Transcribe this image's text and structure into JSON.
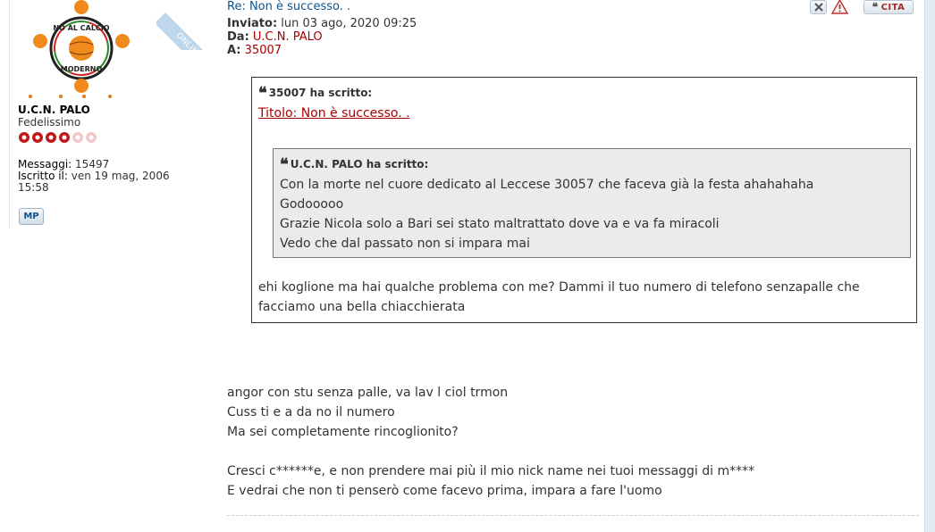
{
  "profile": {
    "username": "U.C.N. PALO",
    "rank": "Fedelissimo",
    "online_label": "ONLINE",
    "avatar_text": [
      "NO AL CALCIO",
      "MODERNO"
    ],
    "stats": [
      {
        "label": "Messaggi:",
        "value": "15497"
      },
      {
        "label": "Iscritto il:",
        "value": "ven 19 mag, 2006 15:58"
      }
    ],
    "pm_label": "MP",
    "rank_stars_filled": 4,
    "rank_stars_total": 6
  },
  "post": {
    "title": "Re: Non è successo. .",
    "sent_label": "Inviato:",
    "sent_value": "lun 03 ago, 2020 09:25",
    "from_label": "Da:",
    "from_value": "U.C.N. PALO",
    "to_label": "A:",
    "to_value": "35007"
  },
  "actions": {
    "delete_icon": "close-icon",
    "report_icon": "warning-icon",
    "quote_label": "CITA"
  },
  "quote": {
    "author_line": "35007 ha scritto:",
    "link_text": "Titolo: Non è successo. .",
    "inner": {
      "author_line": "U.C.N. PALO ha scritto:",
      "lines": [
        "Con la morte nel cuore dedicato al Leccese 30057 che faceva già la festa ahahahaha",
        "Godooooo",
        "Grazie Nicola solo a Bari sei stato maltrattato dove va e va fa miracoli",
        "Vedo che dal passato non si impara mai"
      ]
    },
    "text": "ehi koglione ma hai qualche problema con me? Dammi il tuo numero di telefono senzapalle che facciamo una bella chiacchierata"
  },
  "reply": {
    "lines": [
      "angor con stu senza palle, va lav l ciol trmon",
      "Cuss ti e a da no il numero",
      "Ma sei completamente rincoglionito?",
      "",
      "Cresci c******e, e non prendere mai più il mio nick name nei tuoi messaggi di m****",
      "E vedrai che non ti penserò come facevo prima, impara a fare l'uomo"
    ]
  },
  "colors": {
    "link": "#105289",
    "red": "#aa0000",
    "quote_bg": "#ebebeb",
    "strip": "#e1ebf2"
  }
}
